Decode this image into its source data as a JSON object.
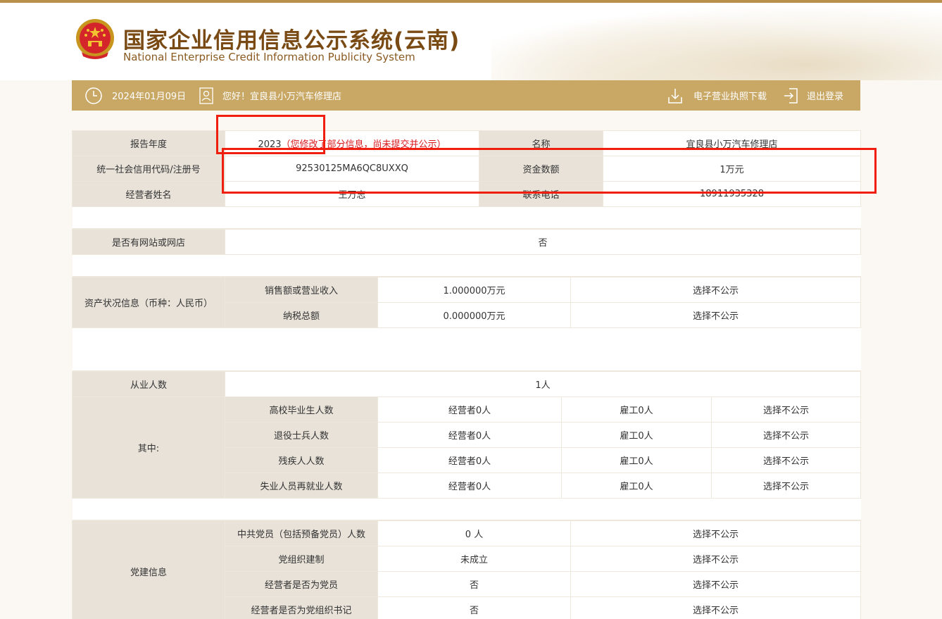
{
  "header": {
    "title_cn": "国家企业信用信息公示系统(云南)",
    "title_en": "National Enterprise Credit Information Publicity System"
  },
  "nav": {
    "date": "2024年01月09日",
    "greeting": "您好！宜良县小万汽车修理店",
    "download_label": "电子营业执照下载",
    "logout_label": "退出登录"
  },
  "basic": {
    "year_label": "报告年度",
    "year_value": "2023",
    "year_note": "（您修改了部分信息，尚未提交并公示）",
    "name_label": "名称",
    "name_value": "宜良县小万汽车修理店",
    "code_label": "统一社会信用代码/注册号",
    "code_value": "92530125MA6QC8UXXQ",
    "capital_label": "资金数额",
    "capital_value": "1万元",
    "operator_label": "经营者姓名",
    "operator_value": "王万志",
    "phone_label": "联系电话",
    "phone_value": "18911935328"
  },
  "website": {
    "label": "是否有网站或网店",
    "value": "否"
  },
  "assets": {
    "label": "资产状况信息（币种：人民币）",
    "rows": [
      {
        "name": "销售额或营业收入",
        "value": "1.000000万元",
        "status": "选择不公示"
      },
      {
        "name": "纳税总额",
        "value": "0.000000万元",
        "status": "选择不公示"
      }
    ]
  },
  "employees": {
    "label": "从业人数",
    "value": "1人",
    "sub_label": "其中:",
    "rows": [
      {
        "name": "高校毕业生人数",
        "operator": "经营者0人",
        "employee": "雇工0人",
        "status": "选择不公示"
      },
      {
        "name": "退役士兵人数",
        "operator": "经营者0人",
        "employee": "雇工0人",
        "status": "选择不公示"
      },
      {
        "name": "残疾人人数",
        "operator": "经营者0人",
        "employee": "雇工0人",
        "status": "选择不公示"
      },
      {
        "name": "失业人员再就业人数",
        "operator": "经营者0人",
        "employee": "雇工0人",
        "status": "选择不公示"
      }
    ]
  },
  "party": {
    "label": "党建信息",
    "rows": [
      {
        "name": "中共党员（包括预备党员）人数",
        "value": "0 人",
        "status": "选择不公示"
      },
      {
        "name": "党组织建制",
        "value": "未成立",
        "status": "选择不公示"
      },
      {
        "name": "经营者是否为党员",
        "value": "否",
        "status": "选择不公示"
      },
      {
        "name": "经营者是否为党组织书记",
        "value": "否",
        "status": "选择不公示"
      }
    ]
  },
  "colors": {
    "brand_gold": "#c9a866",
    "highlight_red": "#f01e0e",
    "label_bg": "#e8e2d9"
  }
}
